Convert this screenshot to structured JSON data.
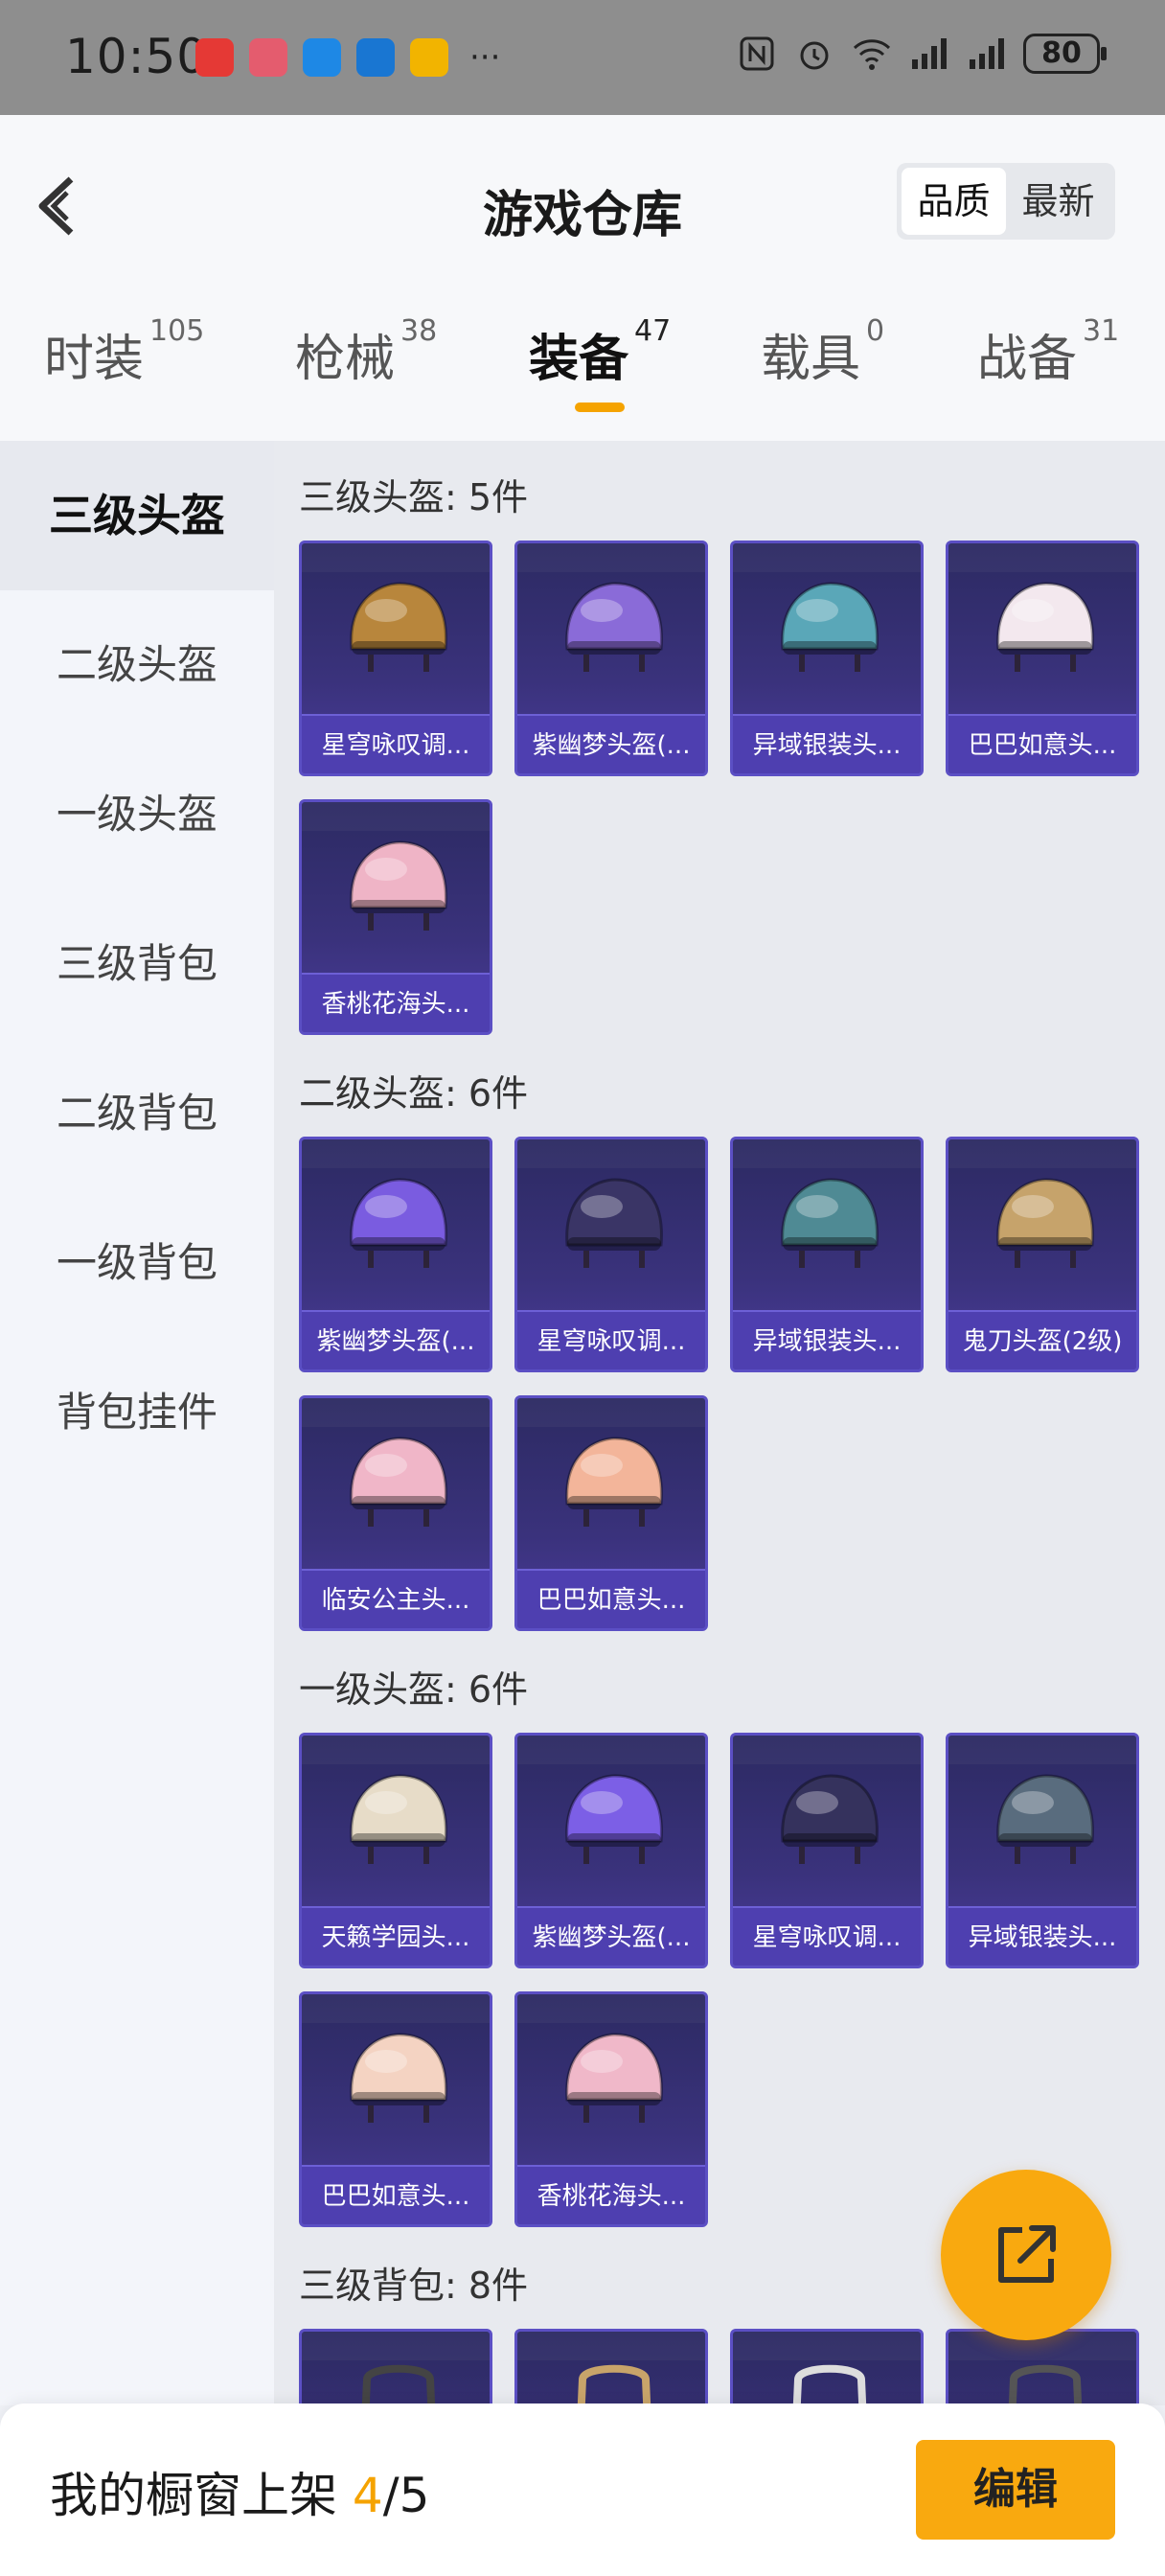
{
  "status_bar": {
    "time": "10:50",
    "battery": "80",
    "colors": {
      "bg": "#8e8e8e"
    }
  },
  "header": {
    "title": "游戏仓库",
    "sort_options": [
      "品质",
      "最新"
    ],
    "selected_sort": "品质"
  },
  "tabs": [
    {
      "label": "时装",
      "count": "105"
    },
    {
      "label": "枪械",
      "count": "38"
    },
    {
      "label": "装备",
      "count": "47",
      "active": true
    },
    {
      "label": "载具",
      "count": "0"
    },
    {
      "label": "战备",
      "count": "31"
    }
  ],
  "sidebar": {
    "items": [
      {
        "label": "三级头盔",
        "active": true
      },
      {
        "label": "二级头盔"
      },
      {
        "label": "一级头盔"
      },
      {
        "label": "三级背包"
      },
      {
        "label": "二级背包"
      },
      {
        "label": "一级背包"
      },
      {
        "label": "背包挂件"
      }
    ]
  },
  "sections": [
    {
      "title": "三级头盔: 5件",
      "items": [
        {
          "name": "星穹咏叹调...",
          "icon": "gold-purple-helmet",
          "color": "#b8863c"
        },
        {
          "name": "紫幽梦头盔(...",
          "icon": "purple-flower-helmet",
          "color": "#8a6bd8"
        },
        {
          "name": "异域银装头...",
          "icon": "teal-visor-helmet",
          "color": "#5aa7b8"
        },
        {
          "name": "巴巴如意头...",
          "icon": "white-pink-visor-helmet",
          "color": "#f3e8ee"
        },
        {
          "name": "香桃花海头...",
          "icon": "pink-visor-helmet",
          "color": "#efb4c6"
        }
      ]
    },
    {
      "title": "二级头盔: 6件",
      "items": [
        {
          "name": "紫幽梦头盔(...",
          "icon": "purple-helmet",
          "color": "#7a5ce0"
        },
        {
          "name": "星穹咏叹调...",
          "icon": "dark-winged-helmet",
          "color": "#3a3566"
        },
        {
          "name": "异域银装头...",
          "icon": "silver-teal-helmet",
          "color": "#4f8a94"
        },
        {
          "name": "鬼刀头盔(2级)",
          "icon": "gold-helmet",
          "color": "#c6a36b"
        },
        {
          "name": "临安公主头...",
          "icon": "pink-princess-helmet",
          "color": "#f0b6c8"
        },
        {
          "name": "巴巴如意头...",
          "icon": "peach-helmet",
          "color": "#f3b59a"
        }
      ]
    },
    {
      "title": "一级头盔: 6件",
      "items": [
        {
          "name": "天籁学园头...",
          "icon": "cream-open-helmet",
          "color": "#e7dcc8"
        },
        {
          "name": "紫幽梦头盔(...",
          "icon": "purple-open-helmet",
          "color": "#7c5fe6"
        },
        {
          "name": "星穹咏叹调...",
          "icon": "dark-open-helmet",
          "color": "#35325d"
        },
        {
          "name": "异域银装头...",
          "icon": "silver-open-helmet",
          "color": "#596c7e"
        },
        {
          "name": "巴巴如意头...",
          "icon": "white-orange-open-helmet",
          "color": "#f4d3c2"
        },
        {
          "name": "香桃花海头...",
          "icon": "pink-open-helmet",
          "color": "#f0b8c9"
        }
      ]
    },
    {
      "title": "三级背包: 8件",
      "items": [
        {
          "name": "",
          "icon": "backpack",
          "color": "#444"
        },
        {
          "name": "",
          "icon": "backpack",
          "color": "#c8a46a"
        },
        {
          "name": "",
          "icon": "backpack",
          "color": "#ddd"
        },
        {
          "name": "",
          "icon": "backpack",
          "color": "#555"
        }
      ]
    }
  ],
  "bottom_bar": {
    "shelf_label": "我的橱窗上架",
    "shelf_current": "4",
    "shelf_total": "/5",
    "edit_label": "编辑",
    "accent": "#f9a90f"
  },
  "fab": {
    "icon": "share-out-icon"
  }
}
